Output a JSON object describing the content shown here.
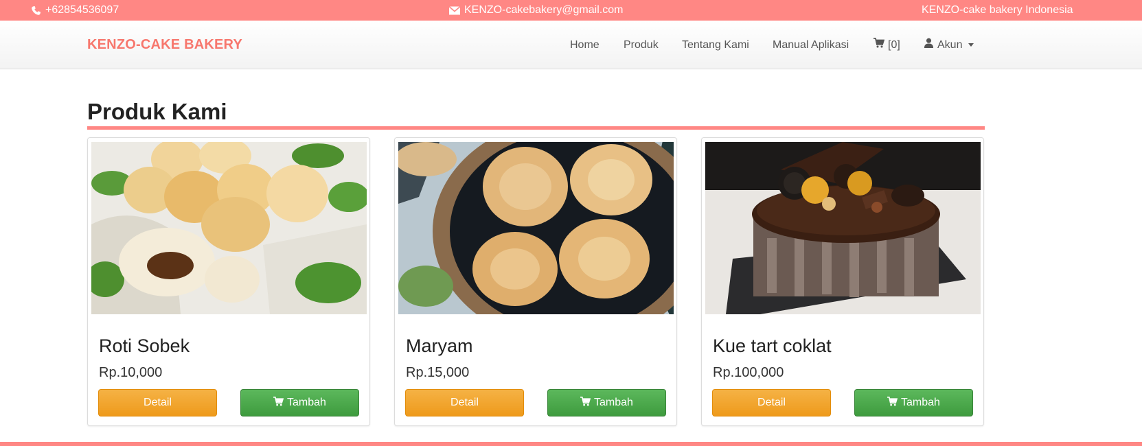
{
  "topbar": {
    "phone": "+62854536097",
    "email": "KENZO-cakebakery@gmail.com",
    "tagline": "KENZO-cake bakery Indonesia",
    "icons": {
      "phone": "phone-icon",
      "email": "envelope-icon"
    }
  },
  "navbar": {
    "brand": "KENZO-CAKE BAKERY",
    "links": {
      "home": "Home",
      "produk": "Produk",
      "tentang": "Tentang Kami",
      "manual": "Manual Aplikasi",
      "cart": "[0]",
      "akun": "Akun"
    },
    "icons": {
      "cart": "cart-icon",
      "akun": "user-icon",
      "dropdown": "caret-down-icon"
    }
  },
  "section": {
    "title": "Produk Kami"
  },
  "products": [
    {
      "name": "Roti Sobek",
      "price": "Rp.10,000",
      "detail_label": "Detail",
      "add_label": "Tambah",
      "image": "roti-sobek-photo"
    },
    {
      "name": "Maryam",
      "price": "Rp.15,000",
      "detail_label": "Detail",
      "add_label": "Tambah",
      "image": "maryam-photo"
    },
    {
      "name": "Kue tart coklat",
      "price": "Rp.100,000",
      "detail_label": "Detail",
      "add_label": "Tambah",
      "image": "chocolate-cake-photo"
    }
  ],
  "colors": {
    "accent": "#ff8784",
    "brand": "#f7776d",
    "detail_button": "#ee9a1b",
    "add_button": "#3e9b3e"
  }
}
